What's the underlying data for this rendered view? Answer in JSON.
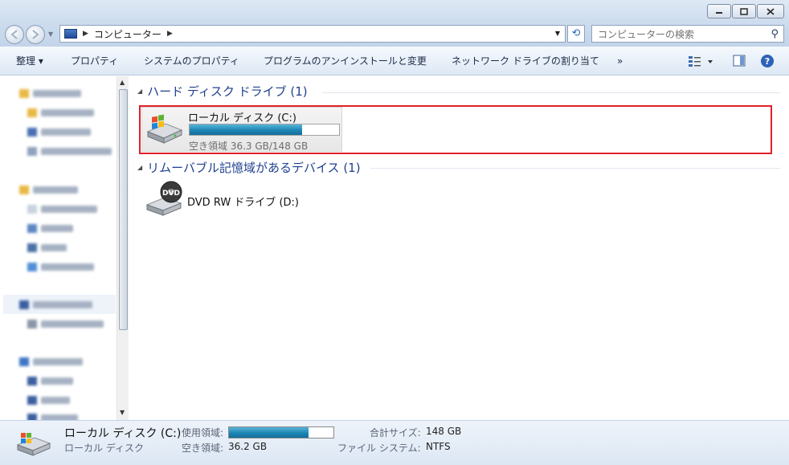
{
  "address": {
    "crumb": "コンピューター",
    "search_placeholder": "コンピューターの検索"
  },
  "toolbar": {
    "organize": "整理 ▾",
    "properties": "プロパティ",
    "system_properties": "システムのプロパティ",
    "uninstall": "プログラムのアンインストールと変更",
    "map_drive": "ネットワーク ドライブの割り当て",
    "more": "»"
  },
  "groups": {
    "hdd": "ハード ディスク ドライブ (1)",
    "removable": "リムーバブル記憶域があるデバイス (1)"
  },
  "drive_c": {
    "name": "ローカル ディスク (C:)",
    "free_text": "空き領域 36.3 GB/148 GB",
    "used_fraction": 0.75
  },
  "drive_d": {
    "name": "DVD RW ドライブ (D:)",
    "badge": "DVD"
  },
  "details": {
    "name": "ローカル ディスク (C:)",
    "type": "ローカル ディスク",
    "used_label": "使用領域:",
    "free_label": "空き領域:",
    "free_value": "36.2 GB",
    "total_label": "合計サイズ:",
    "total_value": "148 GB",
    "fs_label": "ファイル システム:",
    "fs_value": "NTFS",
    "used_fraction": 0.76
  },
  "colors": {
    "accent": "#1e3f8e",
    "highlight": "#e0202a",
    "bar": "#1d85b4"
  }
}
